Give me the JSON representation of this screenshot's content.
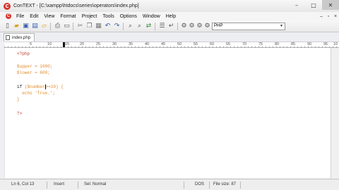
{
  "window": {
    "app_icon_letter": "C",
    "title": "ConTEXT - [C:\\xampp\\htdocs\\series\\operators\\index.php]",
    "minimize": "–",
    "maximize": "□",
    "close": "✕"
  },
  "menu": {
    "items": [
      "File",
      "Edit",
      "View",
      "Format",
      "Project",
      "Tools",
      "Options",
      "Window",
      "Help"
    ],
    "mdi_minimize": "–",
    "mdi_restore": "▫",
    "mdi_close": "×"
  },
  "toolbar": {
    "language": "PHP",
    "icons": [
      "new-file-icon",
      "open-folder-icon",
      "save-icon",
      "save-all-icon",
      "close-file-icon",
      "print-icon",
      "preview-icon",
      "cut-icon",
      "copy-icon",
      "paste-icon",
      "undo-icon",
      "redo-icon",
      "find-icon",
      "find-next-icon",
      "replace-icon",
      "indent-icon",
      "wrap-icon",
      "user-tool-1-icon",
      "user-tool-2-icon",
      "user-tool-3-icon",
      "user-tool-4-icon"
    ]
  },
  "tabs": [
    {
      "label": "index.php"
    }
  ],
  "ruler": {
    "labels": [
      "5",
      "10",
      "15",
      "20",
      "25",
      "30",
      "35",
      "40",
      "45",
      "50",
      "55",
      "60",
      "65",
      "70",
      "75",
      "80",
      "85",
      "90",
      "95",
      "10"
    ]
  },
  "code": {
    "line1": "<?php",
    "line3_var": "$upper",
    "line3_rest": " = 1000;",
    "line4_var": "$lower",
    "line4_rest": " = 600;",
    "line6_kw": "if ",
    "line6_var": "($number",
    "line6_rest": ">=10) {",
    "line7": "  echo 'True.';",
    "line8": "}",
    "line10": "?>"
  },
  "status": {
    "position": "Ln 6, Col 13",
    "mode": "Insert",
    "selection": "Sel: Normal",
    "line_endings": "DOS",
    "file_size": "File size: 87"
  }
}
